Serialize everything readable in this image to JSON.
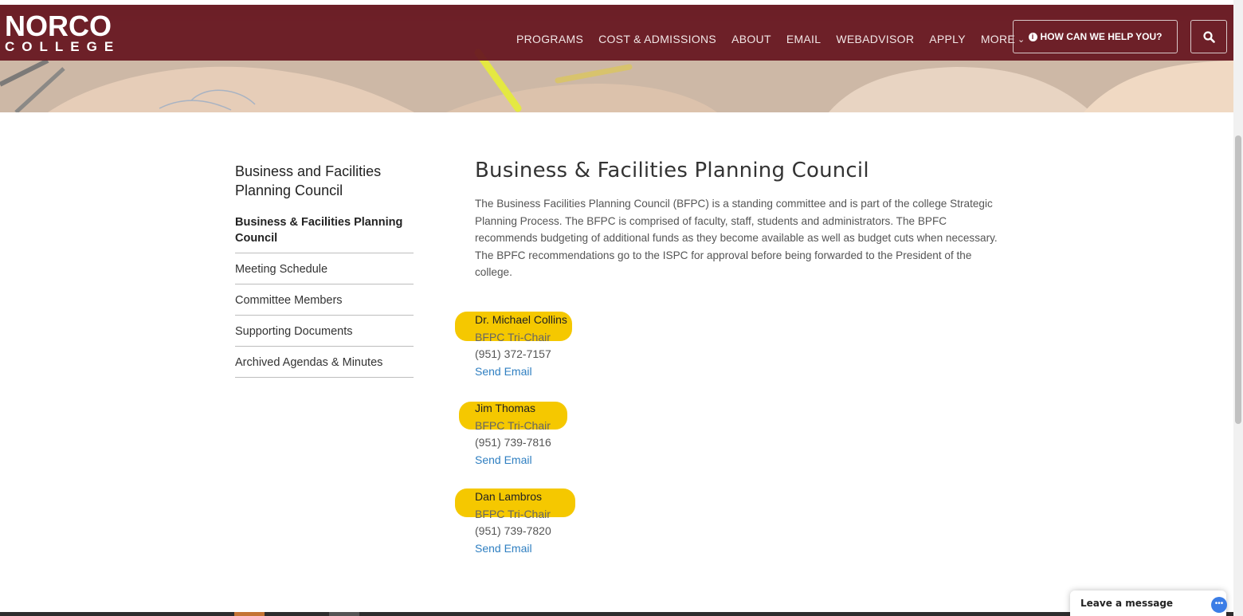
{
  "header": {
    "logo_main": "NORCO",
    "logo_sub": "COLLEGE",
    "nav": [
      "PROGRAMS",
      "COST & ADMISSIONS",
      "ABOUT",
      "EMAIL",
      "WEBADVISOR",
      "APPLY"
    ],
    "more_label": "MORE",
    "help_label": "HOW CAN WE HELP YOU?",
    "icons": {
      "info": "info-icon",
      "search": "search-icon",
      "more": "chevron-down-icon"
    },
    "colors": {
      "bar": "#6a1520",
      "text": "#ffffff"
    }
  },
  "sidebar": {
    "title": "Business and Facilities Planning Council",
    "items": [
      {
        "label": "Business & Facilities Planning Council",
        "active": true
      },
      {
        "label": "Meeting Schedule"
      },
      {
        "label": "Committee Members"
      },
      {
        "label": "Supporting Documents"
      },
      {
        "label": "Archived Agendas & Minutes"
      }
    ]
  },
  "main": {
    "title": "Business & Facilities Planning Council",
    "intro": "The Business Facilities Planning Council (BFPC) is a standing committee and is part of the college Strategic Planning Process. The BFPC is comprised of faculty, staff, students and administrators. The BPFC recommends budgeting of additional funds as they become available as well as budget cuts when necessary. The BPFC recommendations go to the ISPC for approval before being forwarded to the President of the college.",
    "contacts": [
      {
        "name": "Dr. Michael Collins",
        "role": "BFPC Tri-Chair",
        "phone": "(951) 372-7157",
        "email_label": "Send Email"
      },
      {
        "name": "Jim Thomas",
        "role": "BFPC Tri-Chair",
        "phone": "(951) 739-7816",
        "email_label": "Send Email"
      },
      {
        "name": "Dan Lambros",
        "role": "BFPC Tri-Chair",
        "phone": "(951) 739-7820",
        "email_label": "Send Email"
      }
    ],
    "highlight_color": "#f5c800",
    "link_color": "#2f7fc1"
  },
  "chat": {
    "label": "Leave a message",
    "icon": "chat-bubble-icon"
  }
}
